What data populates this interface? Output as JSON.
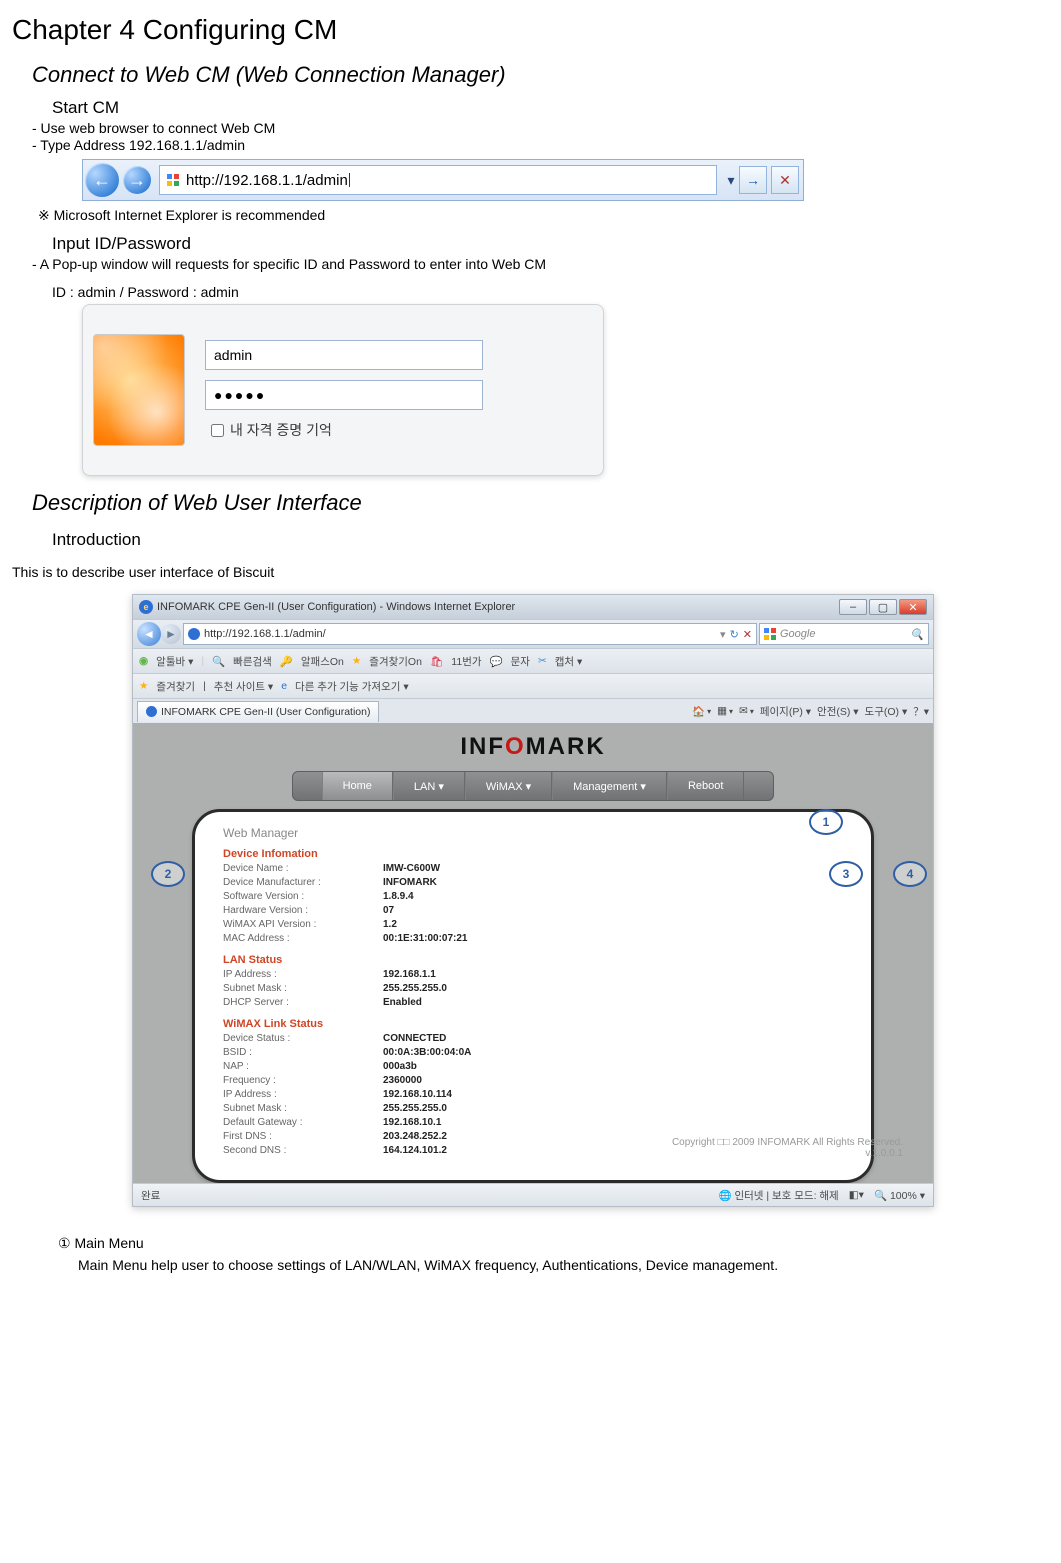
{
  "chapter_title": "Chapter 4 Configuring CM",
  "section1": {
    "title": "Connect to Web CM (Web Connection Manager)",
    "start_cm": "Start CM",
    "line1": "- Use web browser to connect Web CM",
    "line2": "- Type Address 192.168.1.1/admin",
    "addr_url": "http://192.168.1.1/admin",
    "note": "※  Microsoft Internet Explorer is recommended",
    "input_hdr": "Input ID/Password",
    "input_line": "-    A Pop-up window will requests for specific ID and Password to enter into Web CM",
    "cred": "ID : admin / Password : admin",
    "login_user": "admin",
    "login_pass": "●●●●●",
    "login_chk": "내 자격 증명 기억"
  },
  "section2": {
    "title": "Description of Web User Interface",
    "intro_hdr": "Introduction",
    "intro_body": "This is to describe user interface of Biscuit"
  },
  "ie": {
    "title": "INFOMARK CPE Gen-II (User Configuration) - Windows Internet Explorer",
    "addr": "http://192.168.1.1/admin/",
    "search_ph": "Google",
    "toolbar": [
      "알툴바 ▾",
      "빠른검색",
      "알패스On",
      "즐겨찾기On",
      "11번가",
      "문자",
      "캡처 ▾"
    ],
    "favbar_star": "즐겨찾기",
    "favbar_items": [
      "추천 사이트 ▾",
      "다른 추가 기능 가져오기 ▾"
    ],
    "tab": "INFOMARK CPE Gen-II (User Configuration)",
    "tabmenu": [
      "▾",
      "페이지(P) ▾",
      "안전(S) ▾",
      "도구(O) ▾",
      "？▾"
    ],
    "logo_a": "INF",
    "logo_o": "O",
    "logo_b": "MARK",
    "nav": [
      "Home",
      "LAN ▾",
      "WiMAX ▾",
      "Management ▾",
      "Reboot"
    ],
    "panel_title": "Web Manager",
    "grp1": "Device Infomation",
    "dev": [
      [
        "Device Name :",
        "IMW-C600W"
      ],
      [
        "Device Manufacturer :",
        "INFOMARK"
      ],
      [
        "Software Version :",
        "1.8.9.4"
      ],
      [
        "Hardware Version :",
        "07"
      ],
      [
        "WiMAX API Version :",
        "1.2"
      ],
      [
        "MAC Address :",
        "00:1E:31:00:07:21"
      ]
    ],
    "grp2": "LAN Status",
    "lan": [
      [
        "IP Address :",
        "192.168.1.1"
      ],
      [
        "Subnet Mask :",
        "255.255.255.0"
      ],
      [
        "DHCP Server :",
        "Enabled"
      ]
    ],
    "grp3": "WiMAX Link Status",
    "wx": [
      [
        "Device Status :",
        "CONNECTED"
      ],
      [
        "BSID :",
        "00:0A:3B:00:04:0A"
      ],
      [
        "NAP :",
        "000a3b"
      ],
      [
        "Frequency :",
        "2360000"
      ],
      [
        "IP Address :",
        "192.168.10.114"
      ],
      [
        "Subnet Mask :",
        "255.255.255.0"
      ],
      [
        "Default Gateway :",
        "192.168.10.1"
      ],
      [
        "First DNS :",
        "203.248.252.2"
      ],
      [
        "Second DNS :",
        "164.124.101.2"
      ]
    ],
    "copyright1": "Copyright □□ 2009 INFOMARK All Rights Reserved.",
    "copyright2": "v.1.0.0.1",
    "status_l": "완료",
    "status_r1": "인터넷 | 보호 모드: 해제",
    "status_r2": "100%",
    "badges": {
      "b1": "1",
      "b2": "2",
      "b3": "3",
      "b4": "4"
    }
  },
  "footnote": {
    "num": "① Main Menu",
    "body": "Main Menu help user to choose settings of LAN/WLAN, WiMAX frequency, Authentications, Device management."
  }
}
